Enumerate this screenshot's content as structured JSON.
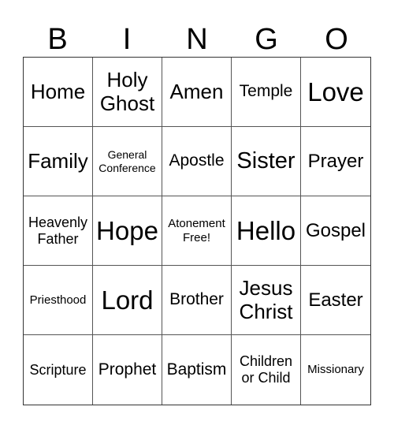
{
  "header": [
    "B",
    "I",
    "N",
    "G",
    "O"
  ],
  "cells": [
    "Home",
    "Holy Ghost",
    "Amen",
    "Temple",
    "Love",
    "Family",
    "General Conference",
    "Apostle",
    "Sister",
    "Prayer",
    "Heavenly Father",
    "Hope",
    "Atonement Free!",
    "Hello",
    "Gospel",
    "Priesthood",
    "Lord",
    "Brother",
    "Jesus Christ",
    "Easter",
    "Scripture",
    "Prophet",
    "Baptism",
    "Children or Child",
    "Missionary"
  ]
}
